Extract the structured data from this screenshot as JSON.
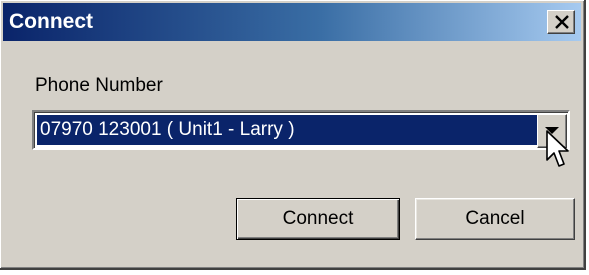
{
  "window": {
    "title": "Connect",
    "close_icon": "close-icon"
  },
  "form": {
    "phone_label": "Phone Number",
    "phone_value": "07970 123001 ( Unit1 - Larry )",
    "dropdown_icon": "chevron-down-icon"
  },
  "buttons": {
    "connect_label": "Connect",
    "cancel_label": "Cancel"
  },
  "colors": {
    "titlebar_start": "#0a246a",
    "titlebar_end": "#a6caf0",
    "dialog_face": "#d4d0c8",
    "selection": "#0a246a"
  }
}
